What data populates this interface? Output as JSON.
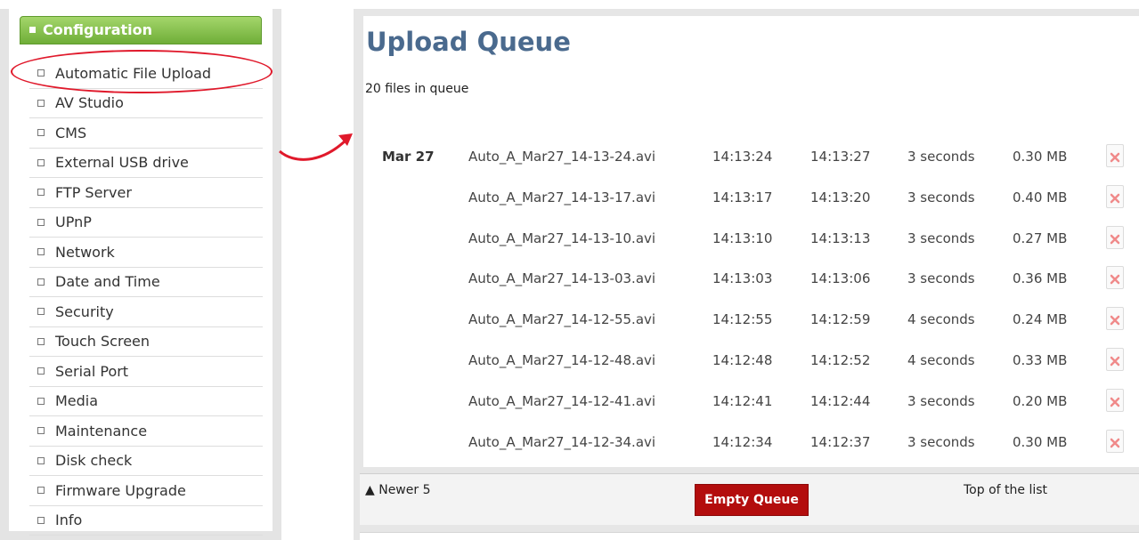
{
  "sidebar": {
    "header": "Configuration",
    "items": [
      {
        "label": "Automatic File Upload"
      },
      {
        "label": "AV Studio"
      },
      {
        "label": "CMS"
      },
      {
        "label": "External USB drive"
      },
      {
        "label": "FTP Server"
      },
      {
        "label": "UPnP"
      },
      {
        "label": "Network"
      },
      {
        "label": "Date and Time"
      },
      {
        "label": "Security"
      },
      {
        "label": "Touch Screen"
      },
      {
        "label": "Serial Port"
      },
      {
        "label": "Media"
      },
      {
        "label": "Maintenance"
      },
      {
        "label": "Disk check"
      },
      {
        "label": "Firmware Upgrade"
      },
      {
        "label": "Info"
      }
    ]
  },
  "main": {
    "title": "Upload Queue",
    "queue_count": "20 files in queue",
    "date_group": "Mar 27",
    "rows": [
      {
        "file": "Auto_A_Mar27_14-13-24.avi",
        "start": "14:13:24",
        "end": "14:13:27",
        "duration": "3 seconds",
        "size": "0.30 MB"
      },
      {
        "file": "Auto_A_Mar27_14-13-17.avi",
        "start": "14:13:17",
        "end": "14:13:20",
        "duration": "3 seconds",
        "size": "0.40 MB"
      },
      {
        "file": "Auto_A_Mar27_14-13-10.avi",
        "start": "14:13:10",
        "end": "14:13:13",
        "duration": "3 seconds",
        "size": "0.27 MB"
      },
      {
        "file": "Auto_A_Mar27_14-13-03.avi",
        "start": "14:13:03",
        "end": "14:13:06",
        "duration": "3 seconds",
        "size": "0.36 MB"
      },
      {
        "file": "Auto_A_Mar27_14-12-55.avi",
        "start": "14:12:55",
        "end": "14:12:59",
        "duration": "4 seconds",
        "size": "0.24 MB"
      },
      {
        "file": "Auto_A_Mar27_14-12-48.avi",
        "start": "14:12:48",
        "end": "14:12:52",
        "duration": "4 seconds",
        "size": "0.33 MB"
      },
      {
        "file": "Auto_A_Mar27_14-12-41.avi",
        "start": "14:12:41",
        "end": "14:12:44",
        "duration": "3 seconds",
        "size": "0.20 MB"
      },
      {
        "file": "Auto_A_Mar27_14-12-34.avi",
        "start": "14:12:34",
        "end": "14:12:37",
        "duration": "3 seconds",
        "size": "0.30 MB"
      }
    ],
    "footer": {
      "newer": "▲ Newer 5",
      "empty_button": "Empty Queue",
      "top_link": "Top of the list"
    }
  },
  "colors": {
    "title": "#4a6a8e",
    "config_green": "#7bb843",
    "highlight_red": "#e0192b",
    "button_red": "#b30d0d"
  },
  "icons": {
    "delete": "delete-file-icon",
    "arrow": "curved-arrow-icon"
  }
}
